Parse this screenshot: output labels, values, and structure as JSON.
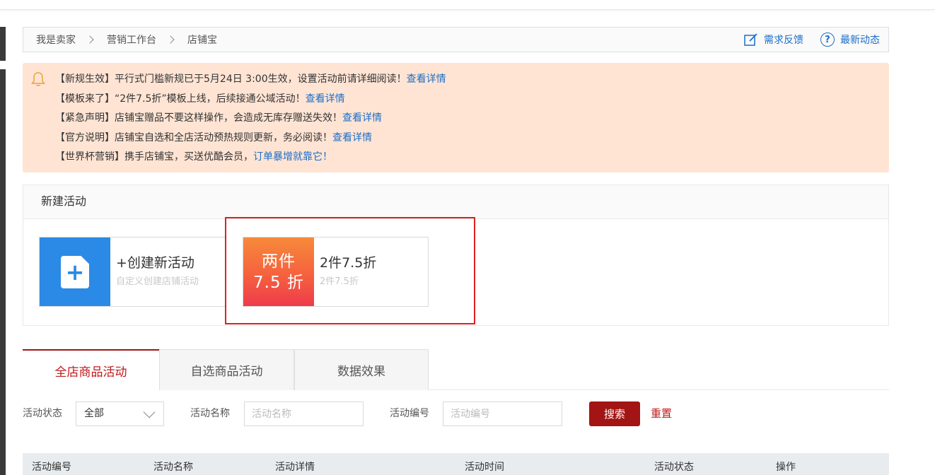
{
  "breadcrumb": {
    "items": [
      "我是卖家",
      "营销工作台",
      "店铺宝"
    ],
    "feedback_label": "需求反馈",
    "news_label": "最新动态"
  },
  "notices": [
    {
      "text": "【新规生效】平行式门槛新规已于5月24日 3:00生效，设置活动前请详细阅读！",
      "link": "查看详情"
    },
    {
      "text": "【模板来了】“2件7.5折”模板上线，后续接通公域活动！",
      "link": "查看详情"
    },
    {
      "text": "【紧急声明】店铺宝赠品不要这样操作，会造成无库存赠送失效！",
      "link": "查看详情"
    },
    {
      "text": "【官方说明】店铺宝自选和全店活动预热规则更新，务必阅读！",
      "link": "查看详情"
    },
    {
      "text": "【世界杯营销】携手店铺宝，买送优酷会员，",
      "link": "订单暴增就靠它！"
    }
  ],
  "new_activity": {
    "heading": "新建活动",
    "cards": [
      {
        "title": "+创建新活动",
        "subtitle": "自定义创建店铺活动"
      },
      {
        "thumb_line1": "两件",
        "thumb_line2": "7.5 折",
        "title": "2件7.5折",
        "subtitle": "2件7.5折"
      }
    ]
  },
  "tabs": [
    "全店商品活动",
    "自选商品活动",
    "数据效果"
  ],
  "filters": {
    "status_label": "活动状态",
    "status_value": "全部",
    "name_label": "活动名称",
    "name_placeholder": "活动名称",
    "id_label": "活动编号",
    "id_placeholder": "活动编号",
    "search_label": "搜索",
    "reset_label": "重置"
  },
  "table": {
    "columns": [
      "活动编号",
      "活动名称",
      "活动详情",
      "活动时间",
      "活动状态",
      "操作"
    ]
  },
  "colors": {
    "accent_red": "#a31414",
    "link_blue": "#1a6ec8",
    "notice_bg": "#ffe4d4",
    "create_blue": "#2b8ae6"
  }
}
